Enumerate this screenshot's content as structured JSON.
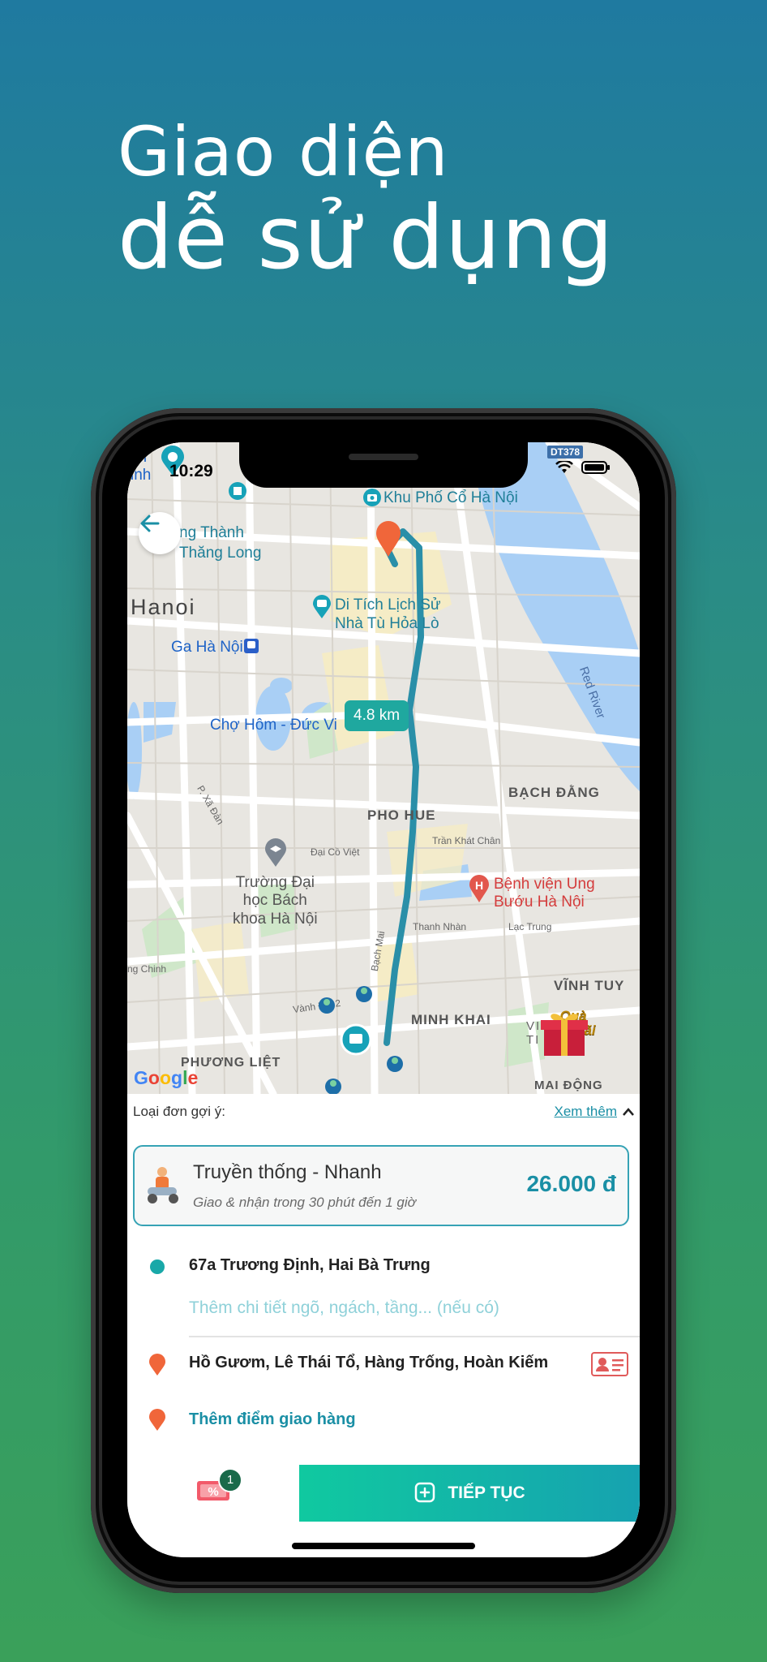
{
  "headline": {
    "line1": "Giao diện",
    "line2": "dễ sử dụng"
  },
  "status": {
    "time": "10:29",
    "tag": "DT378"
  },
  "map": {
    "labels": {
      "corner": "ch\ninh",
      "thang_long": "ng Thành\nThăng Long",
      "hanoi": "Hanoi",
      "khu_pho": "Khu Phố Cổ Hà Nội",
      "di_tich": "Di Tích Lịch Sử\nNhà Tù Hỏa Lò",
      "ga_hanoi": "Ga Hà Nội",
      "cho_hom": "Chợ Hôm - Đức Vi",
      "red_river": "Red River",
      "bach_dang": "BẠCH ĐẰNG",
      "pho_hue": "PHO HUE",
      "xa_dan": "P. Xã Đàn",
      "dai_co_viet": "Đại Cồ Việt",
      "tran_khat_chan": "Trần Khát Chân",
      "truong_dai_hoc": "Trường Đại\nhọc Bách\nkhoa Hà Nội",
      "benh_vien": "Bệnh viện Ung\nBướu Hà Nội",
      "bach_mai": "Bạch Mai",
      "thanh_nhan": "Thanh Nhàn",
      "lac_trung": "Lạc Trung",
      "ng_chinh": "ng Chinh",
      "vinh_tuy": "VĨNH TUY",
      "minh_khai": "MINH KHAI",
      "vong_2": "Vành Đai 2",
      "phuong_liet": "PHƯƠNG LIỆT",
      "times_city": "VI    MES\nTI      ITY",
      "mai_dong": "MAI ĐỘNG",
      "truong_chinh": "Trường Chinh"
    },
    "distance": "4.8 km",
    "gift_caption": "Quà\nƯu Đãi",
    "google": "Google"
  },
  "sheet": {
    "suggest_label": "Loại đơn gợi ý:",
    "see_more": "Xem thêm",
    "order": {
      "title": "Truyền thống - Nhanh",
      "subtitle": "Giao & nhận trong 30 phút đến 1 giờ",
      "price": "26.000 đ"
    },
    "pickup": "67a Trương Định, Hai Bà Trưng",
    "pickup_hint": "Thêm chi tiết ngõ, ngách, tầng... (nếu có)",
    "dropoff": "Hồ Gươm, Lê Thái Tổ, Hàng Trống, Hoàn Kiếm",
    "add_stop": "Thêm điểm giao hàng",
    "promo_count": "1",
    "continue": "TIẾP TỤC"
  },
  "colors": {
    "accent": "#1a8fa5",
    "route": "#1f8fa8",
    "pin": "#f0663a",
    "button_start": "#10c9a0",
    "button_end": "#16a2b0"
  }
}
